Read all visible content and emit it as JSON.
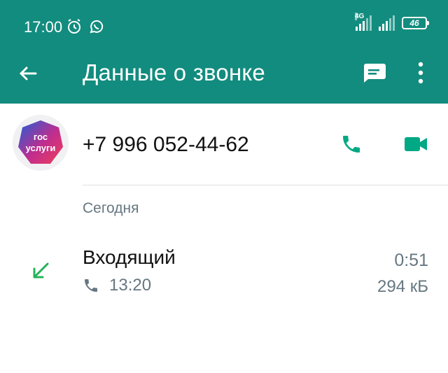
{
  "statusbar": {
    "time": "17:00",
    "icons_left": [
      "alarm-icon",
      "whatsapp-icon"
    ],
    "network_type": "4G",
    "battery": "46"
  },
  "appbar": {
    "title": "Данные о звонке",
    "icons": [
      "back-arrow-icon",
      "message-icon",
      "more-vert-icon"
    ],
    "color": "#128C7E"
  },
  "contact": {
    "avatar_text_line1": "гос",
    "avatar_text_line2": "услуги",
    "phone_number": "+7 996 052-44-62",
    "accent_color": "#00A884"
  },
  "calls": {
    "section_label": "Сегодня",
    "items": [
      {
        "type": "Входящий",
        "duration": "0:51",
        "time": "13:20",
        "size": "294 кБ",
        "direction_icon": "incoming-arrow-icon"
      }
    ]
  }
}
